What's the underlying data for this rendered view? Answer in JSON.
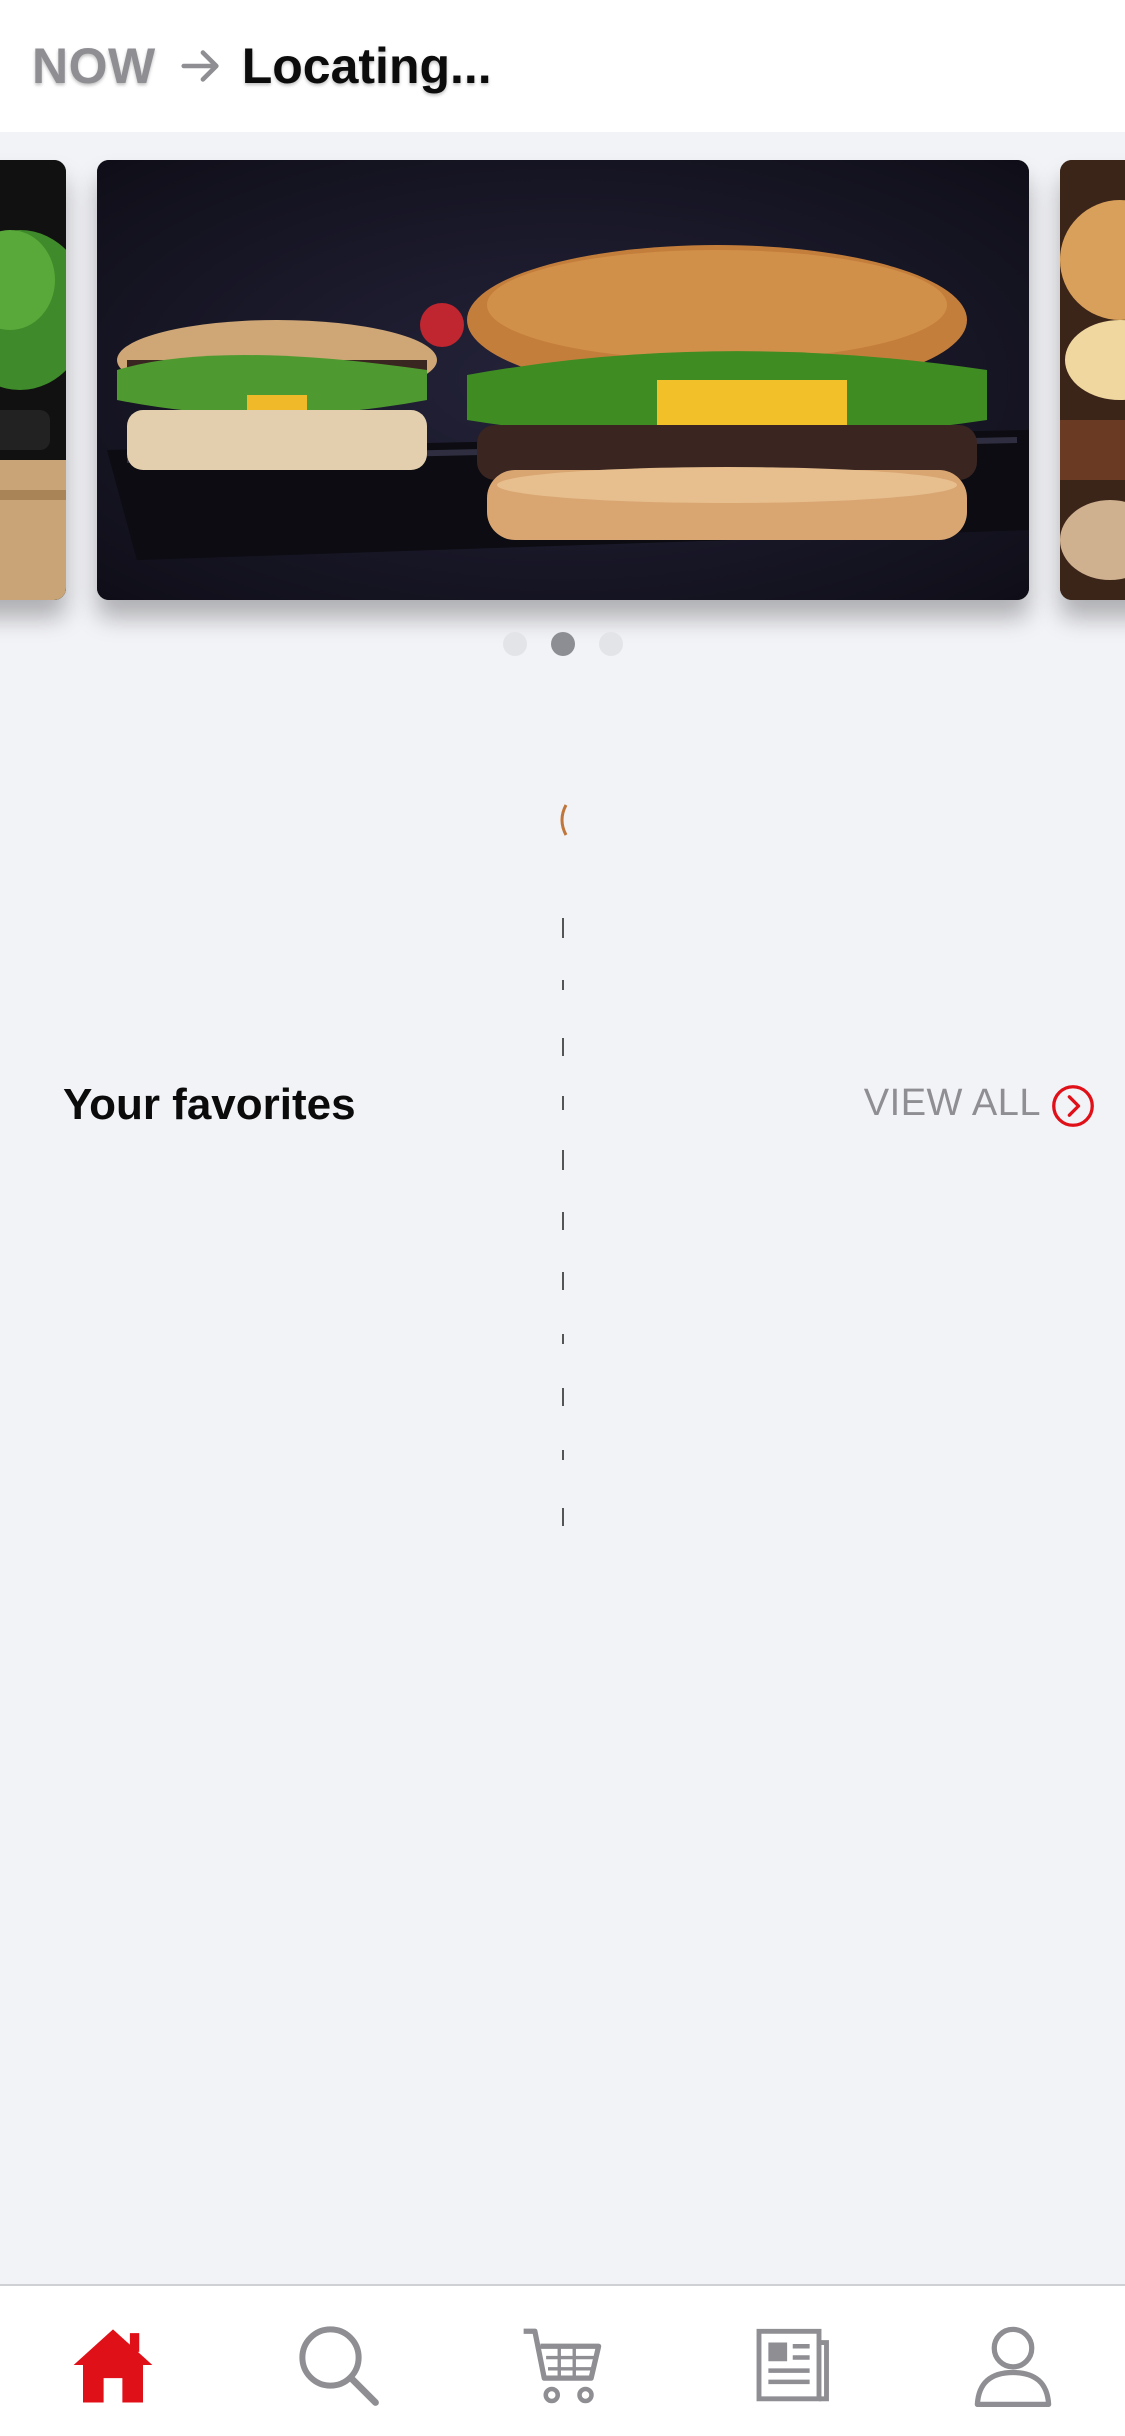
{
  "header": {
    "mode_label": "NOW",
    "location_label": "Locating..."
  },
  "carousel": {
    "pages": 3,
    "active_index": 1,
    "slides": [
      {
        "subject": "food-photo-salad"
      },
      {
        "subject": "food-photo-burgers"
      },
      {
        "subject": "food-photo-sandwich"
      }
    ]
  },
  "favorites": {
    "title": "Your favorites",
    "view_all_label": "VIEW ALL"
  },
  "bottom_nav": {
    "items": [
      {
        "name": "home",
        "icon": "home-icon",
        "active": true
      },
      {
        "name": "search",
        "icon": "search-icon",
        "active": false
      },
      {
        "name": "cart",
        "icon": "cart-icon",
        "active": false
      },
      {
        "name": "news",
        "icon": "news-icon",
        "active": false
      },
      {
        "name": "profile",
        "icon": "profile-icon",
        "active": false
      }
    ]
  },
  "colors": {
    "accent": "#e01019",
    "muted": "#8e8e93",
    "background": "#f2f3f7"
  }
}
